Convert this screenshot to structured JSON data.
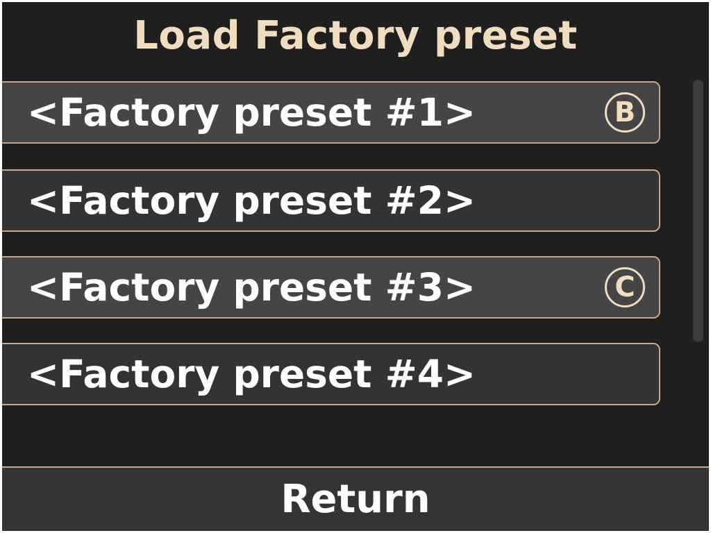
{
  "title": "Load Factory preset",
  "presets": [
    {
      "label": "<Factory preset #1>",
      "badge": "B"
    },
    {
      "label": "<Factory preset #2>",
      "badge": ""
    },
    {
      "label": "<Factory preset #3>",
      "badge": "C"
    },
    {
      "label": "<Factory preset #4>",
      "badge": ""
    }
  ],
  "return_label": "Return",
  "colors": {
    "background": "#1f1f1f",
    "accent": "#f0ddc0",
    "border": "#c8a98a",
    "item_highlight": "#454545",
    "item": "#333333",
    "text": "#ffffff"
  }
}
